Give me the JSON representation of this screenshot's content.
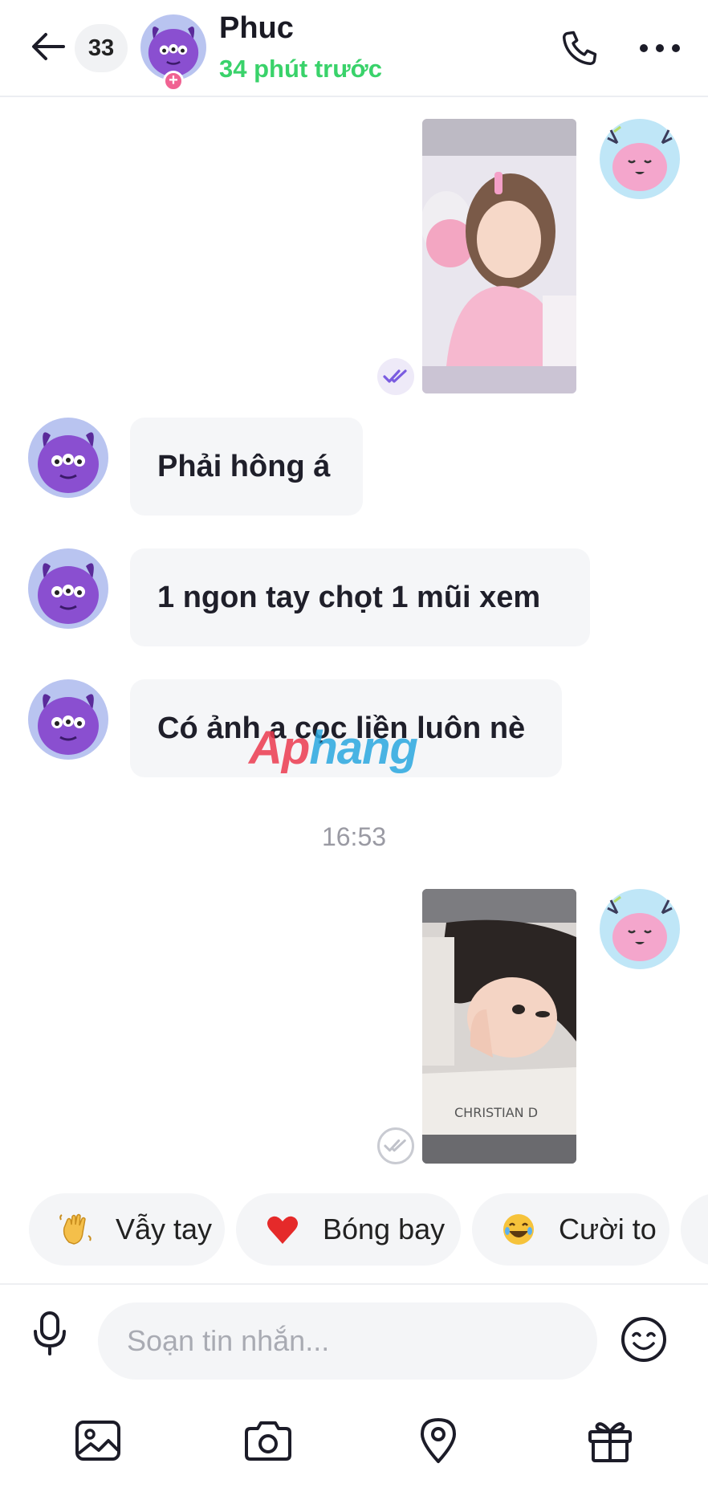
{
  "header": {
    "back_icon": "arrow-left-icon",
    "unread_count": "33",
    "contact_name": "Phuc",
    "status": "34 phút trước",
    "status_color": "#39d26a",
    "call_icon": "phone-icon",
    "more_icon": "more-horizontal-icon"
  },
  "messages": [
    {
      "type": "image",
      "from": "me",
      "read_icon": "double-check-icon",
      "read_state": "read"
    },
    {
      "type": "text",
      "from": "contact",
      "text": "Phải hông á"
    },
    {
      "type": "text",
      "from": "contact",
      "text": "1 ngon tay chọt 1 mũi xem"
    },
    {
      "type": "text",
      "from": "contact",
      "text": "Có ảnh a cọc liền luôn nè"
    },
    {
      "type": "time",
      "text": "16:53"
    },
    {
      "type": "image",
      "from": "me",
      "read_icon": "double-check-icon",
      "read_state": "sent"
    }
  ],
  "watermark": {
    "part1": "Ap",
    "part2": "hang"
  },
  "quick_reactions": [
    {
      "emoji": "waving-hand-icon",
      "label": "Vẫy tay"
    },
    {
      "emoji": "red-heart-icon",
      "label": "Bóng bay"
    },
    {
      "emoji": "laughing-face-icon",
      "label": "Cười to"
    }
  ],
  "input": {
    "placeholder": "Soạn tin nhắn...",
    "value": ""
  },
  "toolbar": [
    "image-icon",
    "camera-icon",
    "location-pin-icon",
    "gift-icon"
  ],
  "colors": {
    "accent": "#7a5ce0",
    "contact_avatar": "#8a4fd0",
    "my_avatar_bg": "#bfe6f7",
    "my_avatar_face": "#f4a6cc",
    "bubble_bg": "#f5f6f8"
  }
}
